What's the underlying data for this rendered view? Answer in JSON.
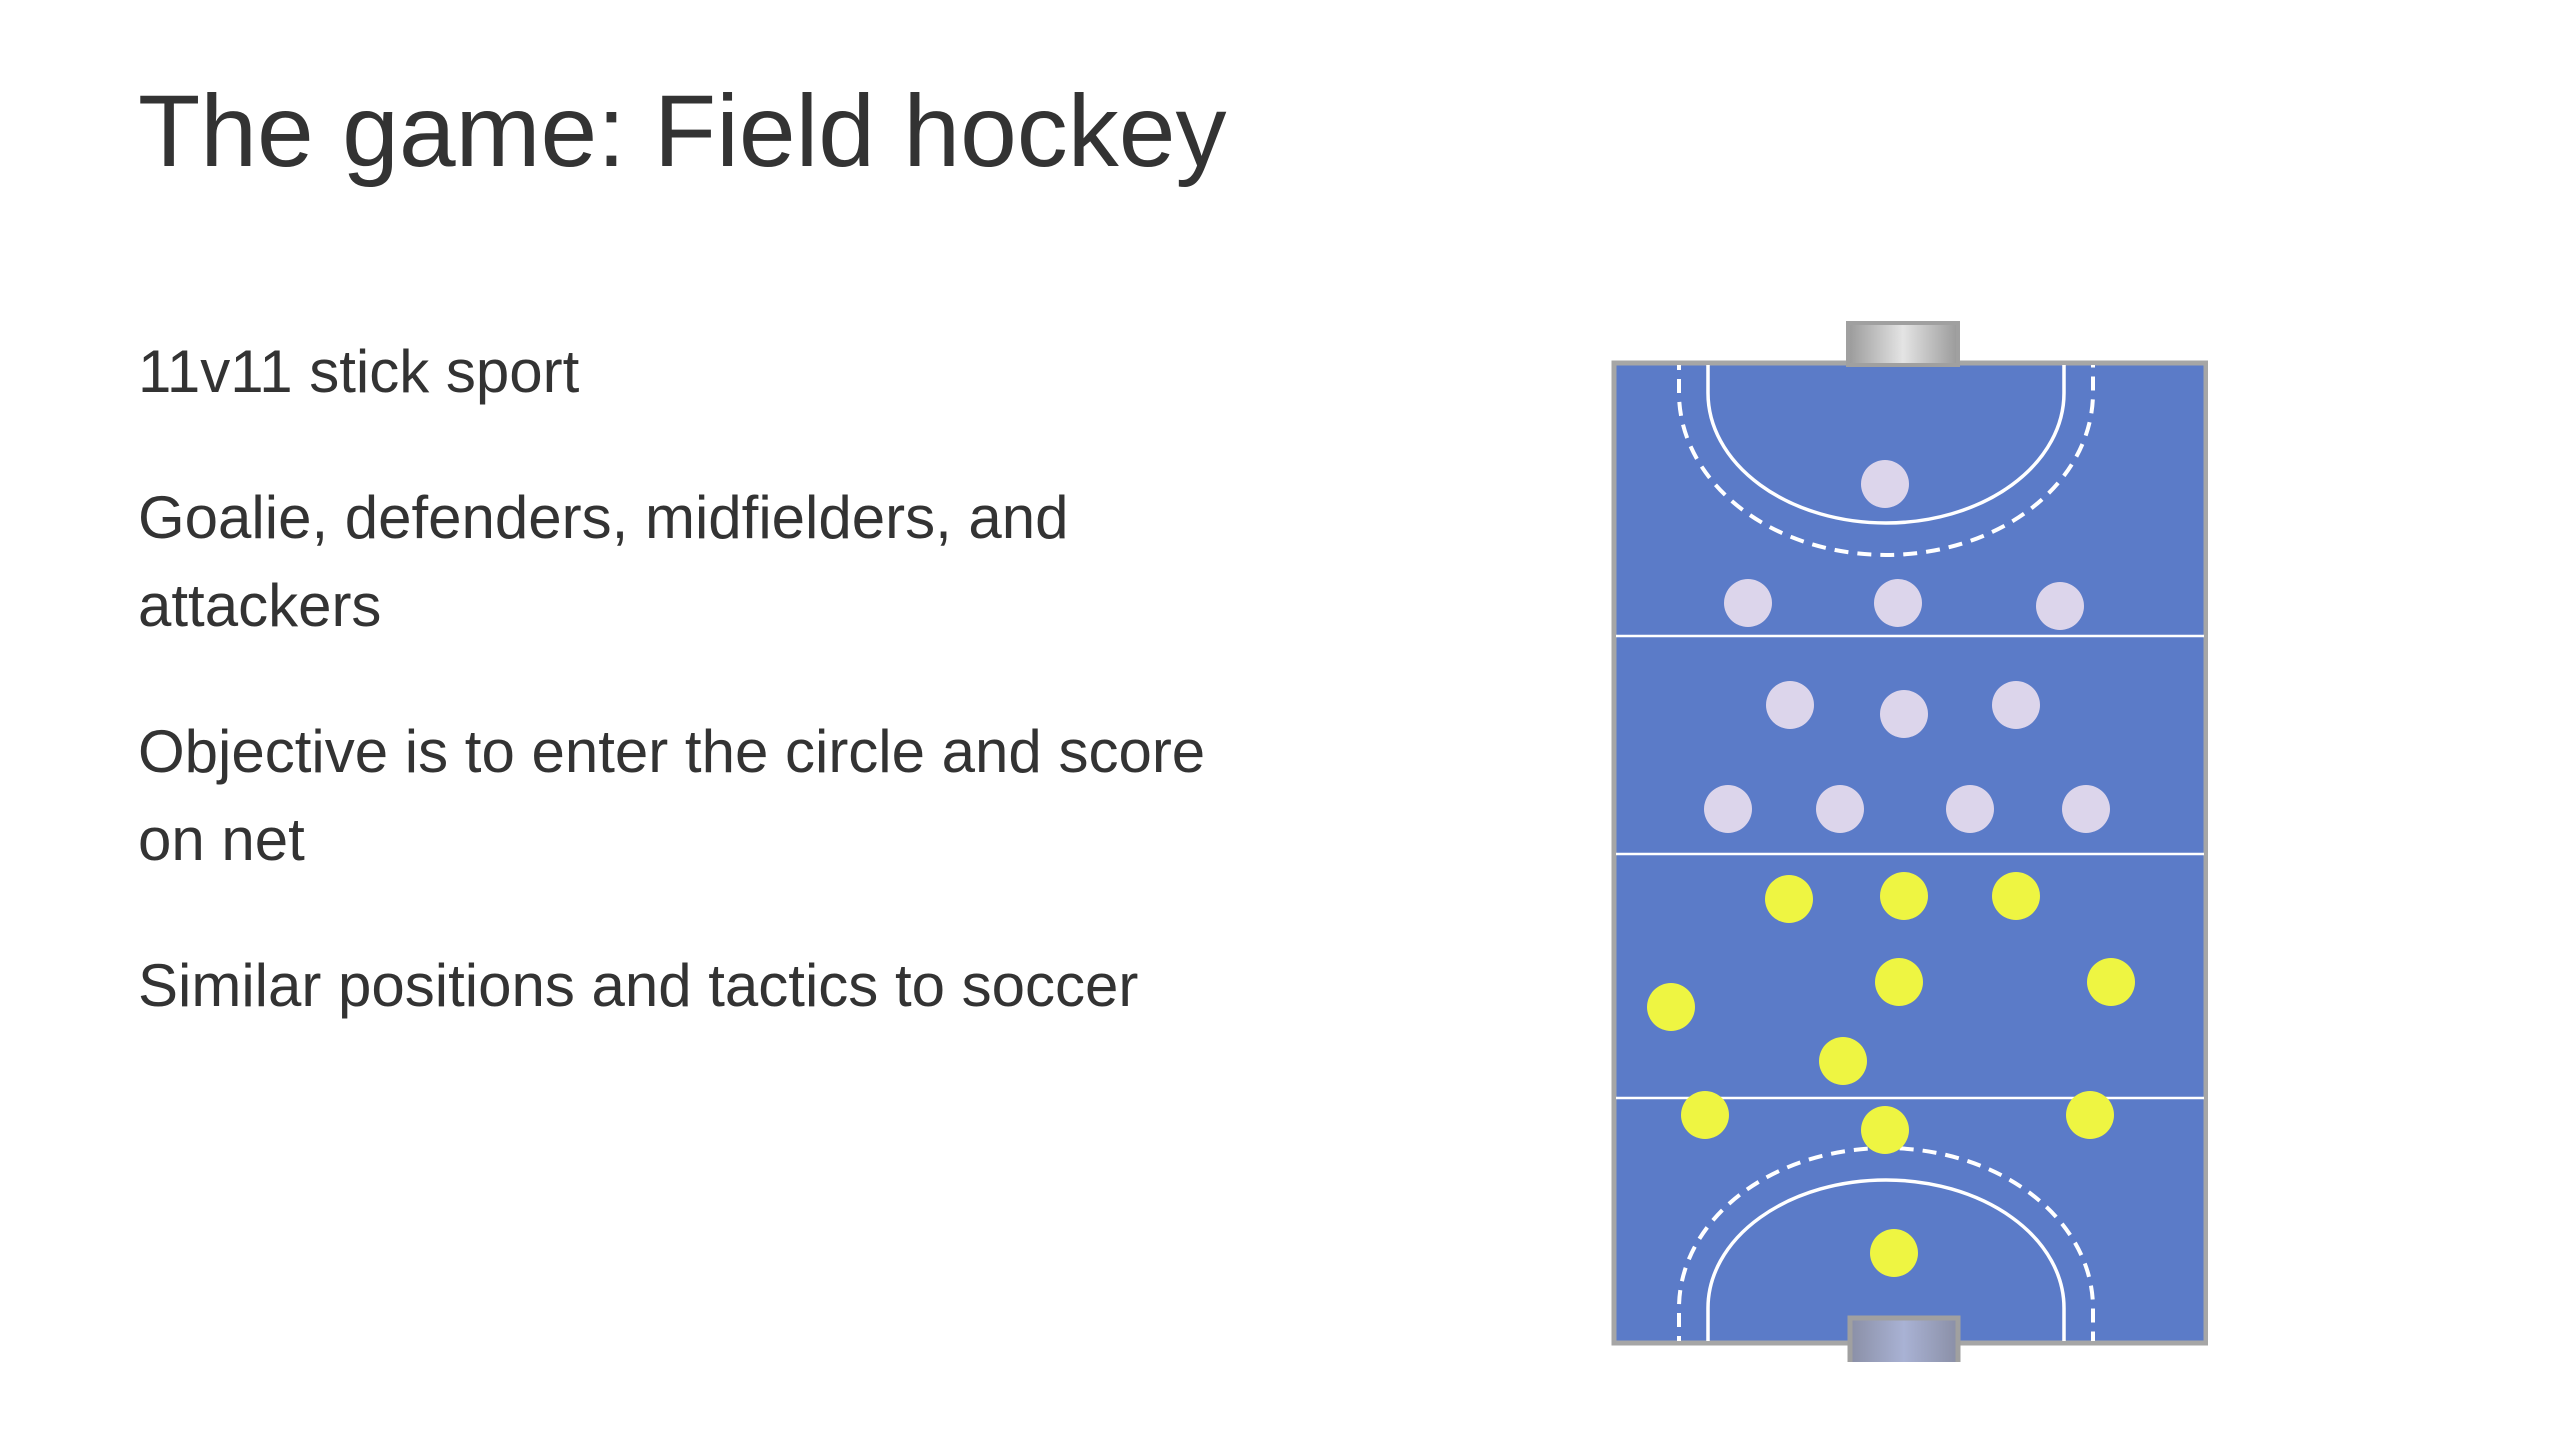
{
  "slide": {
    "title": "The game: Field hockey",
    "bullets": [
      "11v11 stick sport",
      "Goalie, defenders, midfielders, and attackers",
      "Objective is to enter the circle and score on net",
      "Similar positions and tactics to soccer"
    ]
  },
  "diagram": {
    "pitch_color": "#5b7bc8",
    "border_color": "#a6a6a6",
    "line_color": "#ffffff",
    "team_top": {
      "color": "#dcd5eb",
      "player_count": 11
    },
    "team_bottom": {
      "color": "#eef542",
      "player_count": 11
    }
  }
}
